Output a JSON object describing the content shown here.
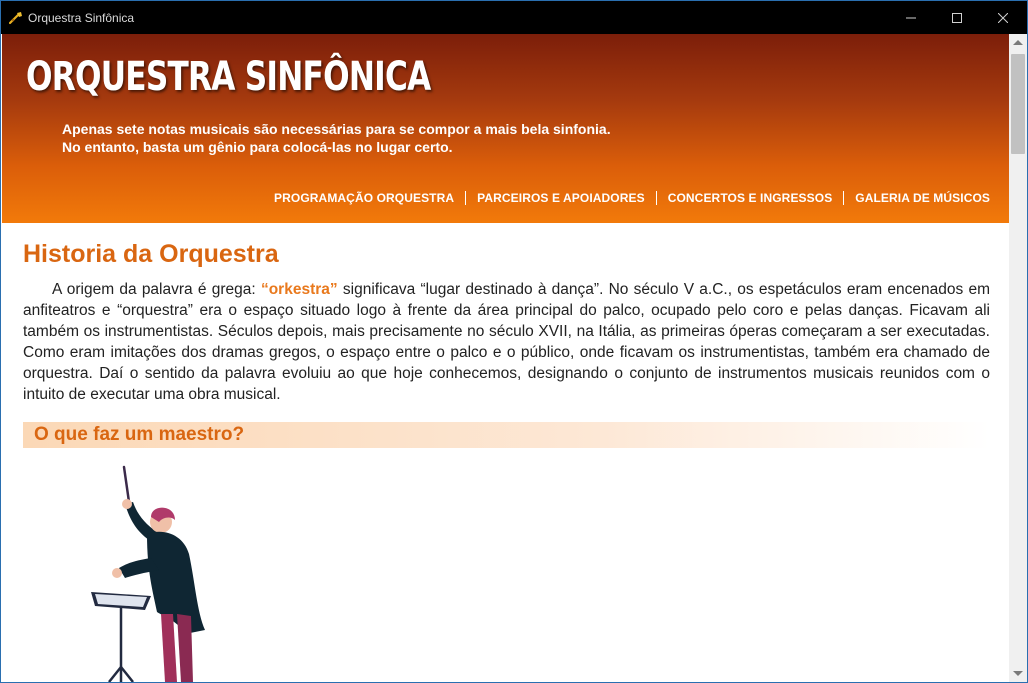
{
  "window": {
    "title": "Orquestra Sinfônica",
    "icon": "trumpet-icon"
  },
  "header": {
    "site_title": "ORQUESTRA SINFÔNICA",
    "tagline_line1": "Apenas sete notas musicais são necessárias para se compor a mais bela sinfonia.",
    "tagline_line2": "No entanto, basta um gênio para colocá-las no lugar certo."
  },
  "nav": {
    "items": [
      {
        "label": "PROGRAMAÇÃO ORQUESTRA"
      },
      {
        "label": "PARCEIROS E APOIADORES"
      },
      {
        "label": "CONCERTOS E INGRESSOS"
      },
      {
        "label": "GALERIA DE MÚSICOS"
      }
    ]
  },
  "main": {
    "section_title": "Historia da Orquestra",
    "paragraph_before": "A origem da palavra é grega: ",
    "paragraph_highlight": "“orkestra”",
    "paragraph_after": " significava “lugar destinado à dança”. No século V a.C., os espetáculos eram encenados em anfiteatros e “orquestra” era o espaço situado logo à frente da área principal do palco, ocupado pelo coro e pelas danças. Ficavam ali também os instrumentistas. Séculos depois, mais precisamente no século XVII, na Itália, as primeiras óperas começaram a ser executadas. Como eram imitações dos dramas gregos, o espaço entre o palco e o público, onde ficavam os instrumentistas, também era chamado de orquestra. Daí o sentido da palavra evoluiu ao que hoje conhecemos, designando o conjunto de instrumentos musicais reunidos com o intuito de executar uma obra musical.",
    "subheading": "O que faz um maestro?"
  },
  "colors": {
    "accent": "#d96611",
    "highlight": "#e9791d",
    "header_dark": "#7c1e0a",
    "header_light": "#f27a0a"
  }
}
